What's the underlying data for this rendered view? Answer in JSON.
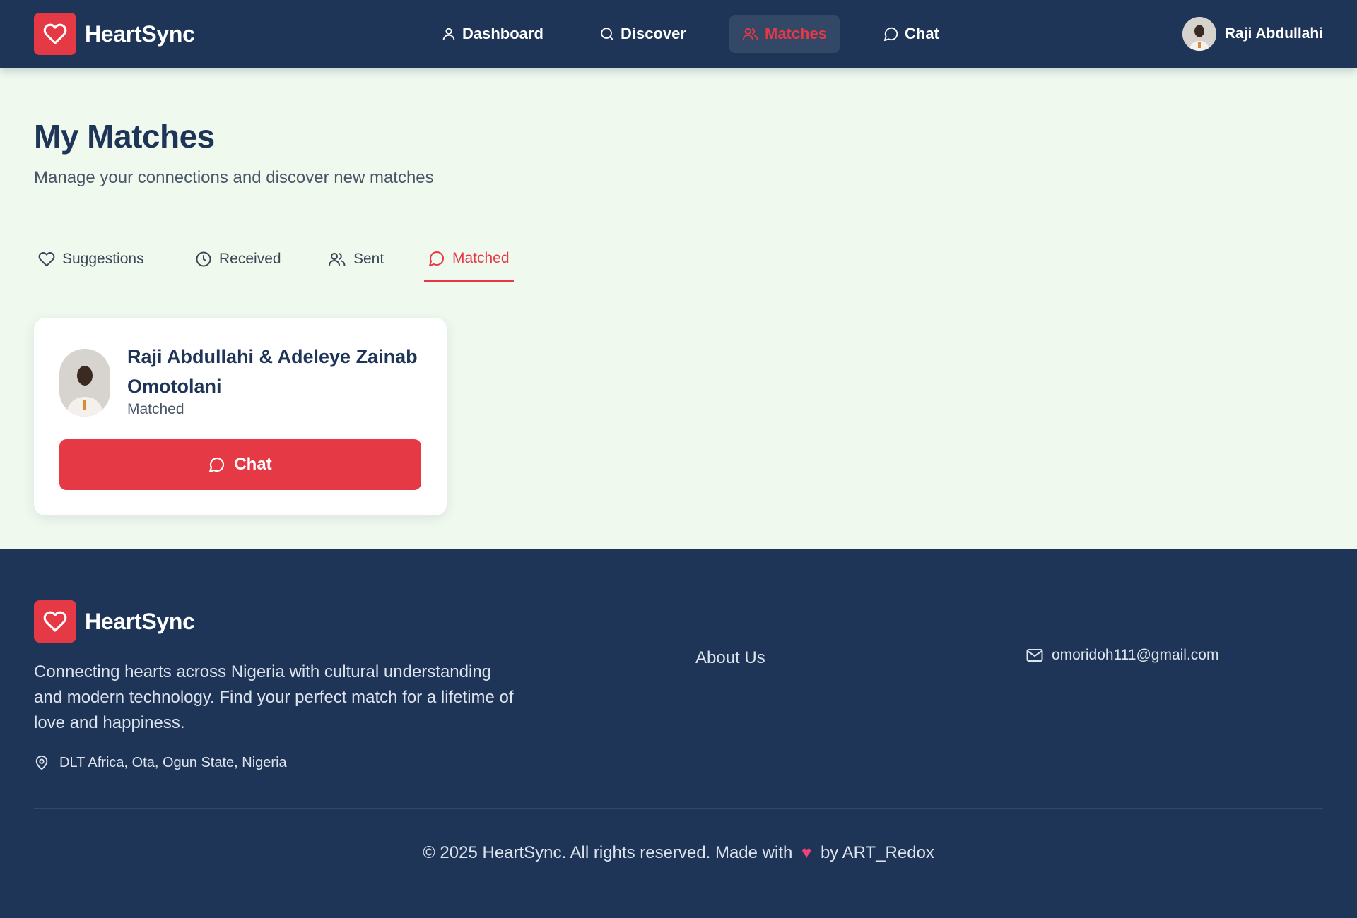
{
  "header": {
    "brand": "HeartSync",
    "nav": [
      {
        "label": "Dashboard",
        "icon": "user-icon"
      },
      {
        "label": "Discover",
        "icon": "search-icon"
      },
      {
        "label": "Matches",
        "icon": "users-icon",
        "active": true
      },
      {
        "label": "Chat",
        "icon": "message-icon"
      }
    ],
    "user_name": "Raji Abdullahi"
  },
  "main": {
    "title": "My Matches",
    "subtitle": "Manage your connections and discover new matches",
    "tabs": [
      {
        "label": "Suggestions",
        "icon": "heart-icon"
      },
      {
        "label": "Received",
        "icon": "clock-icon"
      },
      {
        "label": "Sent",
        "icon": "users-icon"
      },
      {
        "label": "Matched",
        "icon": "message-icon",
        "active": true
      }
    ],
    "matches": [
      {
        "name": "Raji Abdullahi & Adeleye Zainab Omotolani",
        "status": "Matched",
        "button": "Chat"
      }
    ]
  },
  "footer": {
    "brand": "HeartSync",
    "description": "Connecting hearts across Nigeria with cultural understanding and modern technology. Find your perfect match for a lifetime of love and happiness.",
    "location": "DLT Africa, Ota, Ogun State, Nigeria",
    "about_link": "About Us",
    "email": "omoridoh111@gmail.com",
    "copyright_pre": "© 2025 HeartSync. All rights reserved. Made with",
    "copyright_post": "by ART_Redox"
  },
  "colors": {
    "navy": "#1e3558",
    "accent": "#e63946",
    "page_bg": "#f0f9ee"
  }
}
